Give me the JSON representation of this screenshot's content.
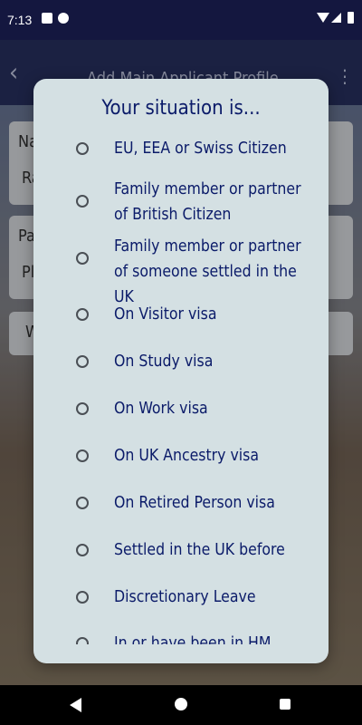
{
  "status_bar": {
    "time": "7:13"
  },
  "app_bar": {
    "title": "Add Main Applicant Profile"
  },
  "background_form": {
    "field1_label": "Na",
    "field1_value": "Ra",
    "field2_label": "Pa",
    "field2_value": "Pl",
    "dropdown_value": "W"
  },
  "dialog": {
    "title": "Your situation is...",
    "options": [
      "EU, EEA or Swiss Citizen",
      "Family member or partner of British Citizen",
      "Family member or partner of someone settled in the UK",
      "On Visitor visa",
      "On Study visa",
      "On Work visa",
      "On UK Ancestry visa",
      "On Retired Person visa",
      "Settled in the UK before",
      "Discretionary Leave",
      "In or have been in HM Forces"
    ]
  },
  "colors": {
    "dialog_bg": "#d4e0e3",
    "option_text": "#0b1b69",
    "radio_border": "#4a4f55"
  }
}
